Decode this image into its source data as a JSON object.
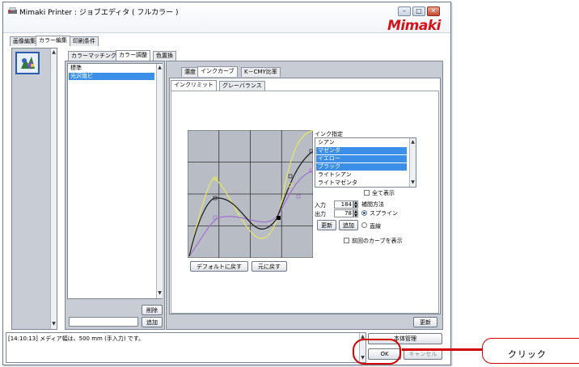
{
  "window": {
    "title": "Mimaki Printer : ジョブエディタ ( フルカラー )",
    "brand": "Mimaki",
    "controls": [
      "minimize",
      "maximize",
      "close"
    ]
  },
  "main_tabs": [
    {
      "label": "画像編集",
      "active": false
    },
    {
      "label": "カラー編集",
      "active": true
    },
    {
      "label": "印刷条件",
      "active": false
    }
  ],
  "sub_tabs": [
    {
      "label": "カラーマッチング",
      "active": false
    },
    {
      "label": "カラー調整",
      "active": true
    },
    {
      "label": "色置換",
      "active": false
    }
  ],
  "profile_list": {
    "items": [
      {
        "label": "標準",
        "selected": false
      },
      {
        "label": "光沢塩ビ",
        "selected": true
      }
    ],
    "delete_label": "削除",
    "add_label": "追加",
    "name_value": ""
  },
  "adjust_tabs": [
    {
      "label": "濃度",
      "active": false
    },
    {
      "label": "インクカーブ",
      "active": true
    },
    {
      "label": "K－CMY比率",
      "active": false
    }
  ],
  "curve_tabs": [
    {
      "label": "インクリミット",
      "active": true
    },
    {
      "label": "グレーバランス",
      "active": false
    }
  ],
  "ink_panel": {
    "header": "インク指定",
    "items": [
      {
        "label": "シアン",
        "selected": false
      },
      {
        "label": "マゼンタ",
        "selected": true
      },
      {
        "label": "イエロー",
        "selected": true
      },
      {
        "label": "ブラック",
        "selected": true
      },
      {
        "label": "ライトシアン",
        "selected": false
      },
      {
        "label": "ライトマゼンタ",
        "selected": false
      }
    ],
    "show_all_label": "全て表示",
    "input_label": "入力",
    "input_value": "184",
    "output_label": "出力",
    "output_value": "78",
    "update_label": "更新",
    "add_label": "追加",
    "interp_label": "補間方法",
    "spline_label": "スプライン",
    "linear_label": "直線",
    "prev_curve_label": "前回のカーブを表示"
  },
  "curve_buttons": {
    "default_label": "デフォルトに戻す",
    "undo_label": "元に戻す"
  },
  "refresh_label": "更新",
  "log_message": "[14:10:13] メディア幅は、500 mm (手入力) です。",
  "bottom_buttons": {
    "job_manage_label": "本体管理",
    "ok_label": "OK",
    "cancel_label": "キャンセル"
  },
  "callout": {
    "text": "クリック",
    "color": "#d40000"
  },
  "colors": {
    "selection": "#3b8fe8",
    "brand_red": "#d4121a",
    "curve_black": "#1a1a1a",
    "curve_yellow": "#e8e860",
    "curve_magenta": "#a070d0"
  }
}
